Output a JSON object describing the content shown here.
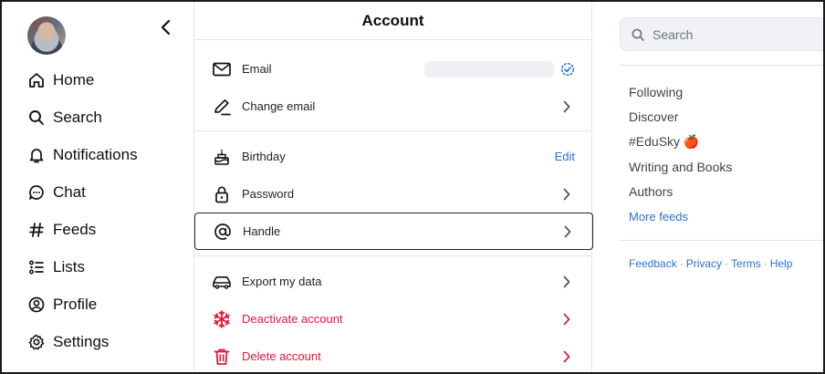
{
  "sidebar": {
    "collapse_icon": "chevron-left-icon",
    "items": [
      {
        "label": "Home",
        "icon": "home-icon"
      },
      {
        "label": "Search",
        "icon": "search-icon"
      },
      {
        "label": "Notifications",
        "icon": "bell-icon"
      },
      {
        "label": "Chat",
        "icon": "chat-icon"
      },
      {
        "label": "Feeds",
        "icon": "hash-icon"
      },
      {
        "label": "Lists",
        "icon": "list-icon"
      },
      {
        "label": "Profile",
        "icon": "profile-icon"
      },
      {
        "label": "Settings",
        "icon": "gear-icon"
      }
    ]
  },
  "account": {
    "title": "Account",
    "rows": [
      {
        "label": "Email",
        "icon": "mail-icon"
      },
      {
        "label": "Change email",
        "icon": "pencil-icon"
      },
      {
        "label": "Birthday",
        "icon": "cake-icon",
        "action": "Edit"
      },
      {
        "label": "Password",
        "icon": "lock-icon"
      },
      {
        "label": "Handle",
        "icon": "at-sign-icon"
      },
      {
        "label": "Export my data",
        "icon": "car-icon"
      },
      {
        "label": "Deactivate account",
        "icon": "snowflake-icon"
      },
      {
        "label": "Delete account",
        "icon": "trash-icon"
      }
    ]
  },
  "right_panel": {
    "search_placeholder": "Search",
    "feeds": [
      "Following",
      "Discover",
      "#EduSky 🍎",
      "Writing and Books",
      "Authors"
    ],
    "more_feeds": "More feeds",
    "footer": [
      "Feedback",
      "Privacy",
      "Terms",
      "Help"
    ],
    "footer_separator": "·"
  },
  "colors": {
    "accent": "#2a72d8",
    "danger": "#e0193a",
    "border": "#e3e6ea"
  }
}
